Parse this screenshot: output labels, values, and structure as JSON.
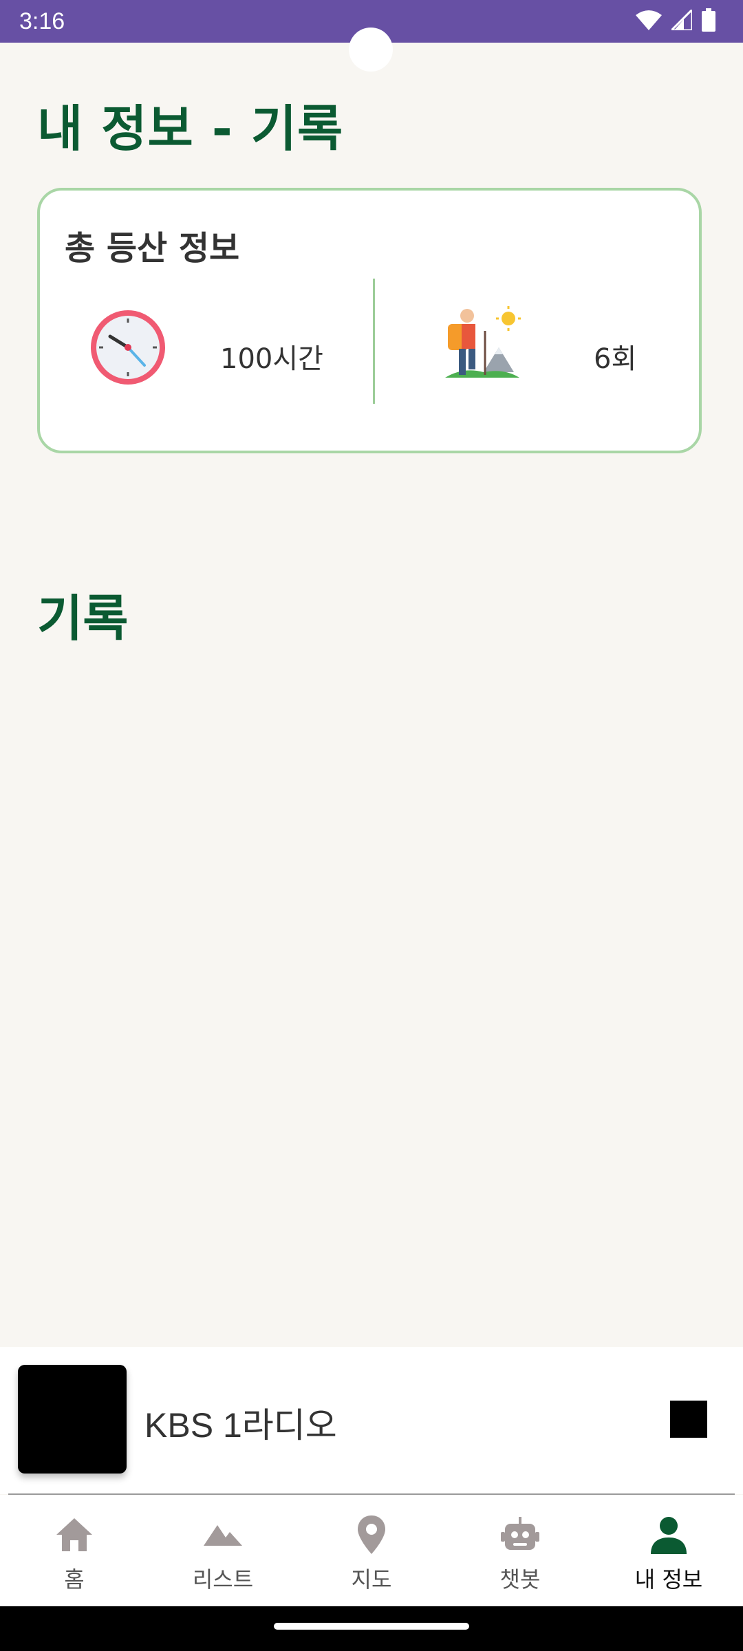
{
  "status_bar": {
    "time": "3:16"
  },
  "header": {
    "title": "내 정보 - 기록"
  },
  "stats": {
    "heading": "총 등산 정보",
    "total_hours": "100시간",
    "total_count": "6회"
  },
  "records": {
    "title": "기록"
  },
  "player": {
    "station": "KBS 1라디오"
  },
  "nav": {
    "items": [
      {
        "label": "홈",
        "icon": "home-icon"
      },
      {
        "label": "리스트",
        "icon": "mountain-icon"
      },
      {
        "label": "지도",
        "icon": "location-pin-icon"
      },
      {
        "label": "챗봇",
        "icon": "robot-icon"
      },
      {
        "label": "내 정보",
        "icon": "person-icon"
      }
    ],
    "active_index": 4
  },
  "colors": {
    "status_bar": "#6750a4",
    "title_green": "#0b5a32",
    "card_border": "#a9d6a6",
    "nav_inactive": "#a29a9a",
    "nav_active": "#0b5a32"
  }
}
